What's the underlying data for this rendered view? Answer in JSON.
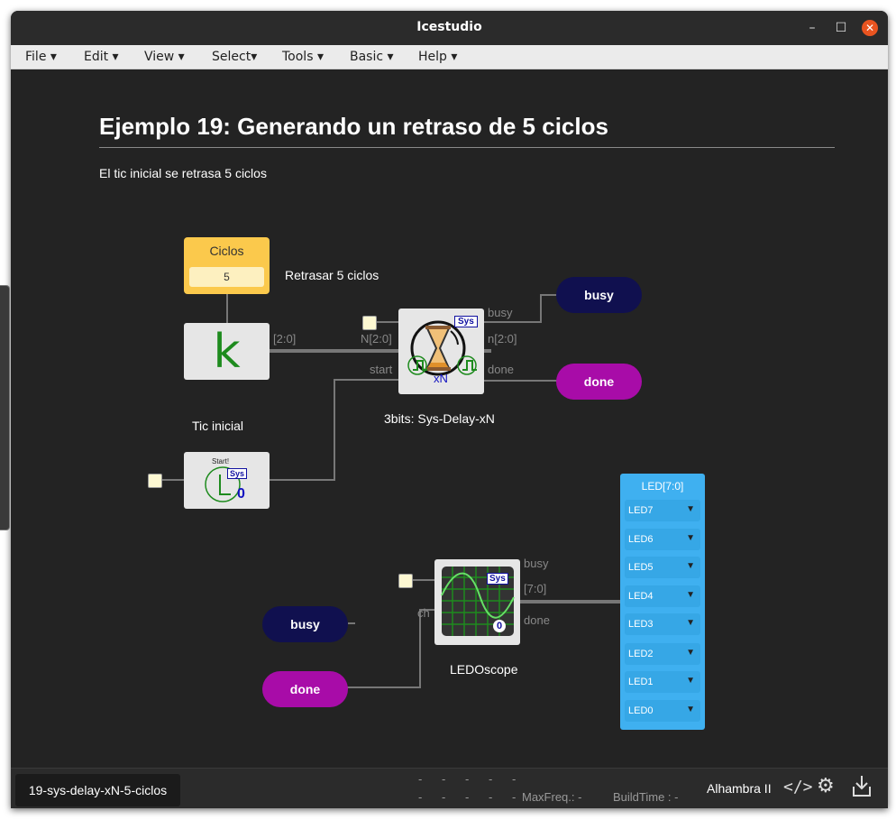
{
  "window": {
    "title": "Icestudio"
  },
  "menu": [
    {
      "label": "File ▾"
    },
    {
      "label": "Edit ▾"
    },
    {
      "label": "View ▾"
    },
    {
      "label": "Select▾"
    },
    {
      "label": "Tools ▾"
    },
    {
      "label": "Basic ▾"
    },
    {
      "label": "Help ▾"
    }
  ],
  "doc": {
    "heading": "Ejemplo 19: Generando un retraso de 5 ciclos",
    "subtext": "El tic inicial se retrasa 5 ciclos"
  },
  "constant": {
    "title": "Ciclos",
    "value": "5",
    "comment": "Retrasar 5 ciclos"
  },
  "k_block": {
    "glyph": "k",
    "bus_label": "[2:0]"
  },
  "delay_block": {
    "name": "3bits: Sys-Delay-xN",
    "badge": "Sys",
    "center_text": "xN",
    "ports": {
      "busy": "busy",
      "n_in": "N[2:0]",
      "n_out": "n[2:0]",
      "start": "start",
      "done": "done"
    }
  },
  "tic": {
    "label": "Tic inicial",
    "start_text": "Start!",
    "badge": "Sys",
    "zero": "0"
  },
  "outputs": {
    "busy": "busy",
    "done": "done"
  },
  "scope": {
    "name": "LEDOscope",
    "badge": "Sys",
    "zero": "0",
    "ports": {
      "busy": "busy",
      "bus": "[7:0]",
      "ch": "ch",
      "done": "done"
    }
  },
  "inputs": {
    "busy": "busy",
    "done": "done"
  },
  "leds": {
    "title": "LED[7:0]",
    "items": [
      "LED7",
      "LED6",
      "LED5",
      "LED4",
      "LED3",
      "LED2",
      "LED1",
      "LED0"
    ]
  },
  "status": {
    "tab": "19-sys-delay-xN-5-ciclos",
    "dashes_row1": "-      -      -      -      -",
    "dashes_row2": "-      -      -      -      -",
    "maxfreq": "MaxFreq.:  -",
    "buildtime": "BuildTime :  -",
    "board": "Alhambra II"
  },
  "colors": {
    "accent": "#e95420",
    "const": "#fbc94c",
    "navy": "#10104f",
    "magenta": "#a80ca8",
    "led": "#3fb0f0"
  },
  "icons": [
    "close-icon",
    "maximize-icon",
    "minimize-icon",
    "code-icon",
    "gear-icon",
    "download-icon"
  ]
}
